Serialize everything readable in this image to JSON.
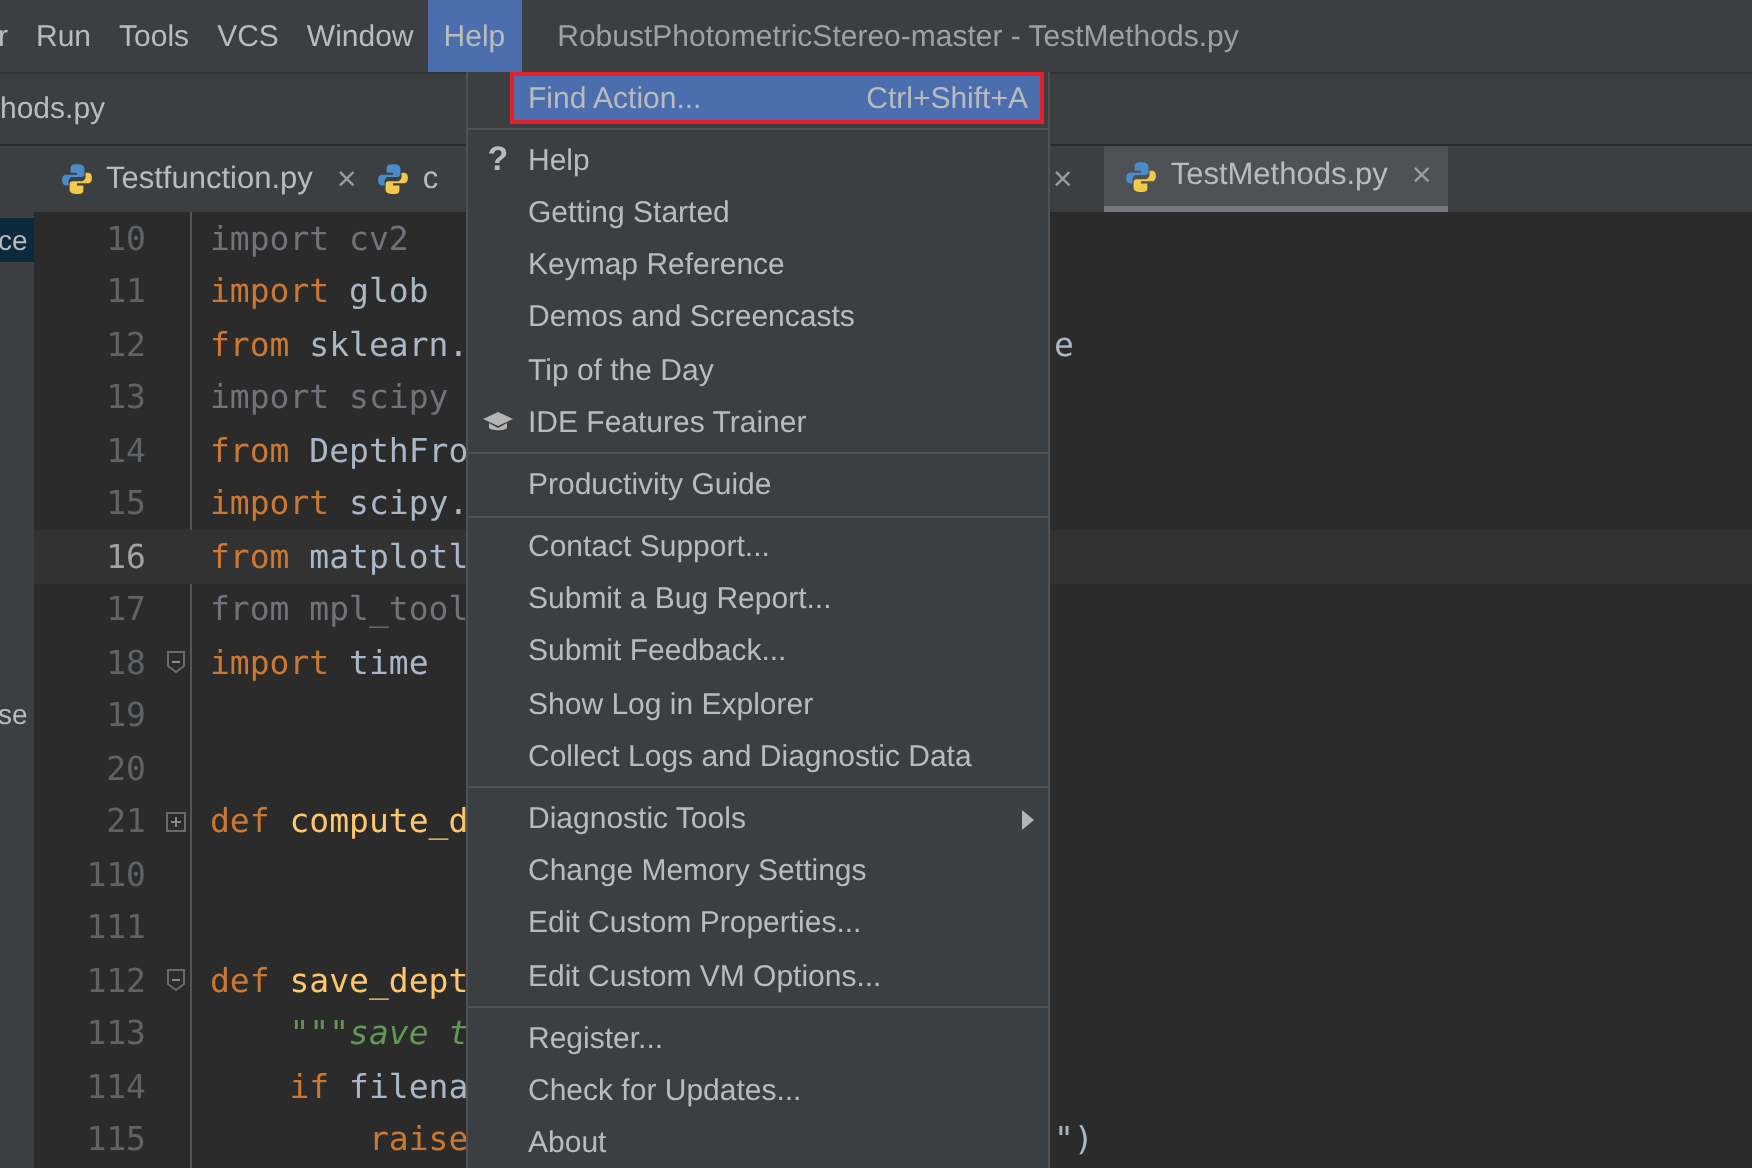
{
  "menubar": {
    "items": [
      {
        "label": "r",
        "selected": false
      },
      {
        "label": "Run",
        "selected": false
      },
      {
        "label": "Tools",
        "selected": false
      },
      {
        "label": "VCS",
        "selected": false
      },
      {
        "label": "Window",
        "selected": false
      },
      {
        "label": "Help",
        "selected": true
      }
    ],
    "title": "RobustPhotometricStereo-master - TestMethods.py"
  },
  "breadcrumb": "hods.py",
  "tabs": [
    {
      "label": "Testfunction.py",
      "selected": false,
      "close": "×"
    },
    {
      "label": "c",
      "selected": false,
      "close": "×"
    },
    {
      "label": "TestMethods.py",
      "selected": true,
      "close": "×"
    }
  ],
  "left_panel": [
    {
      "label": "ce",
      "selected": true
    },
    {
      "label": "se",
      "selected": false
    }
  ],
  "editor": {
    "lines": [
      {
        "number": "10",
        "current": false,
        "tokens": [
          {
            "text": "import cv2",
            "kind": "dim"
          }
        ]
      },
      {
        "number": "11",
        "current": false,
        "tokens": [
          {
            "text": "import",
            "kind": "kw"
          },
          {
            "text": " glob",
            "kind": "id"
          }
        ]
      },
      {
        "number": "12",
        "current": false,
        "tokens": [
          {
            "text": "from",
            "kind": "kw"
          },
          {
            "text": " sklearn.",
            "kind": "id"
          }
        ],
        "tail": "e"
      },
      {
        "number": "13",
        "current": false,
        "tokens": [
          {
            "text": "import scipy",
            "kind": "dim"
          }
        ]
      },
      {
        "number": "14",
        "current": false,
        "tokens": [
          {
            "text": "from",
            "kind": "kw"
          },
          {
            "text": " DepthFro",
            "kind": "id"
          }
        ]
      },
      {
        "number": "15",
        "current": false,
        "tokens": [
          {
            "text": "import",
            "kind": "kw"
          },
          {
            "text": " scipy.",
            "kind": "id"
          }
        ]
      },
      {
        "number": "16",
        "current": true,
        "tokens": [
          {
            "text": "from",
            "kind": "kw"
          },
          {
            "text": " matplotl",
            "kind": "id"
          }
        ]
      },
      {
        "number": "17",
        "current": false,
        "tokens": [
          {
            "text": "from mpl_tool",
            "kind": "dim"
          }
        ]
      },
      {
        "number": "18",
        "current": false,
        "kind": "fold_end",
        "tokens": [
          {
            "text": "import",
            "kind": "kw"
          },
          {
            "text": " time",
            "kind": "id"
          }
        ]
      },
      {
        "number": "19",
        "current": false
      },
      {
        "number": "20",
        "current": false
      },
      {
        "number": "21",
        "current": false,
        "kind": "folded",
        "tokens": [
          {
            "text": "def",
            "kind": "kw"
          },
          {
            "text": " compute_d",
            "kind": "fn"
          }
        ]
      },
      {
        "number": "110",
        "current": false
      },
      {
        "number": "111",
        "current": false
      },
      {
        "number": "112",
        "current": false,
        "kind": "fold_start",
        "tokens": [
          {
            "text": "def",
            "kind": "kw"
          },
          {
            "text": " save_dept",
            "kind": "fn"
          }
        ]
      },
      {
        "number": "113",
        "current": false,
        "tokens": [
          {
            "text": "    \"\"\"save t",
            "kind": "doc"
          }
        ]
      },
      {
        "number": "114",
        "current": false,
        "tokens": [
          {
            "text": "    if",
            "kind": "kw"
          },
          {
            "text": " filena",
            "kind": "id"
          }
        ]
      },
      {
        "number": "115",
        "current": false,
        "tokens": [
          {
            "text": "        raise",
            "kind": "kw"
          }
        ],
        "tail": "\")"
      }
    ]
  },
  "menu": {
    "groups": [
      [
        {
          "label": "Find Action...",
          "shortcut": "Ctrl+Shift+A",
          "kind": "plain",
          "selected": true,
          "outlined": true
        }
      ],
      [
        {
          "label": "Help",
          "kind": "glyph",
          "glyph": "?",
          "selected": false,
          "outlined": false
        },
        {
          "label": "Getting Started",
          "kind": "plain",
          "selected": false,
          "outlined": false
        },
        {
          "label": "Keymap Reference",
          "kind": "plain",
          "selected": false,
          "outlined": false
        },
        {
          "label": "Demos and Screencasts",
          "kind": "plain",
          "selected": false,
          "outlined": false
        },
        {
          "label": "Tip of the Day",
          "kind": "plain",
          "selected": false,
          "outlined": false
        },
        {
          "label": "IDE Features Trainer",
          "kind": "hat",
          "selected": false,
          "outlined": false
        }
      ],
      [
        {
          "label": "Productivity Guide",
          "kind": "plain",
          "selected": false,
          "outlined": false
        }
      ],
      [
        {
          "label": "Contact Support...",
          "kind": "plain",
          "selected": false,
          "outlined": false
        },
        {
          "label": "Submit a Bug Report...",
          "kind": "plain",
          "selected": false,
          "outlined": false
        },
        {
          "label": "Submit Feedback...",
          "kind": "plain",
          "selected": false,
          "outlined": false
        },
        {
          "label": "Show Log in Explorer",
          "kind": "plain",
          "selected": false,
          "outlined": false
        },
        {
          "label": "Collect Logs and Diagnostic Data",
          "kind": "plain",
          "selected": false,
          "outlined": false
        }
      ],
      [
        {
          "label": "Diagnostic Tools",
          "kind": "submenu",
          "selected": false,
          "outlined": false
        },
        {
          "label": "Change Memory Settings",
          "kind": "plain",
          "selected": false,
          "outlined": false
        },
        {
          "label": "Edit Custom Properties...",
          "kind": "plain",
          "selected": false,
          "outlined": false
        },
        {
          "label": "Edit Custom VM Options...",
          "kind": "plain",
          "selected": false,
          "outlined": false
        }
      ],
      [
        {
          "label": "Register...",
          "kind": "plain",
          "selected": false,
          "outlined": false
        },
        {
          "label": "Check for Updates...",
          "kind": "plain",
          "selected": false,
          "outlined": false
        },
        {
          "label": "About",
          "kind": "plain",
          "selected": false,
          "outlined": false
        }
      ]
    ]
  }
}
